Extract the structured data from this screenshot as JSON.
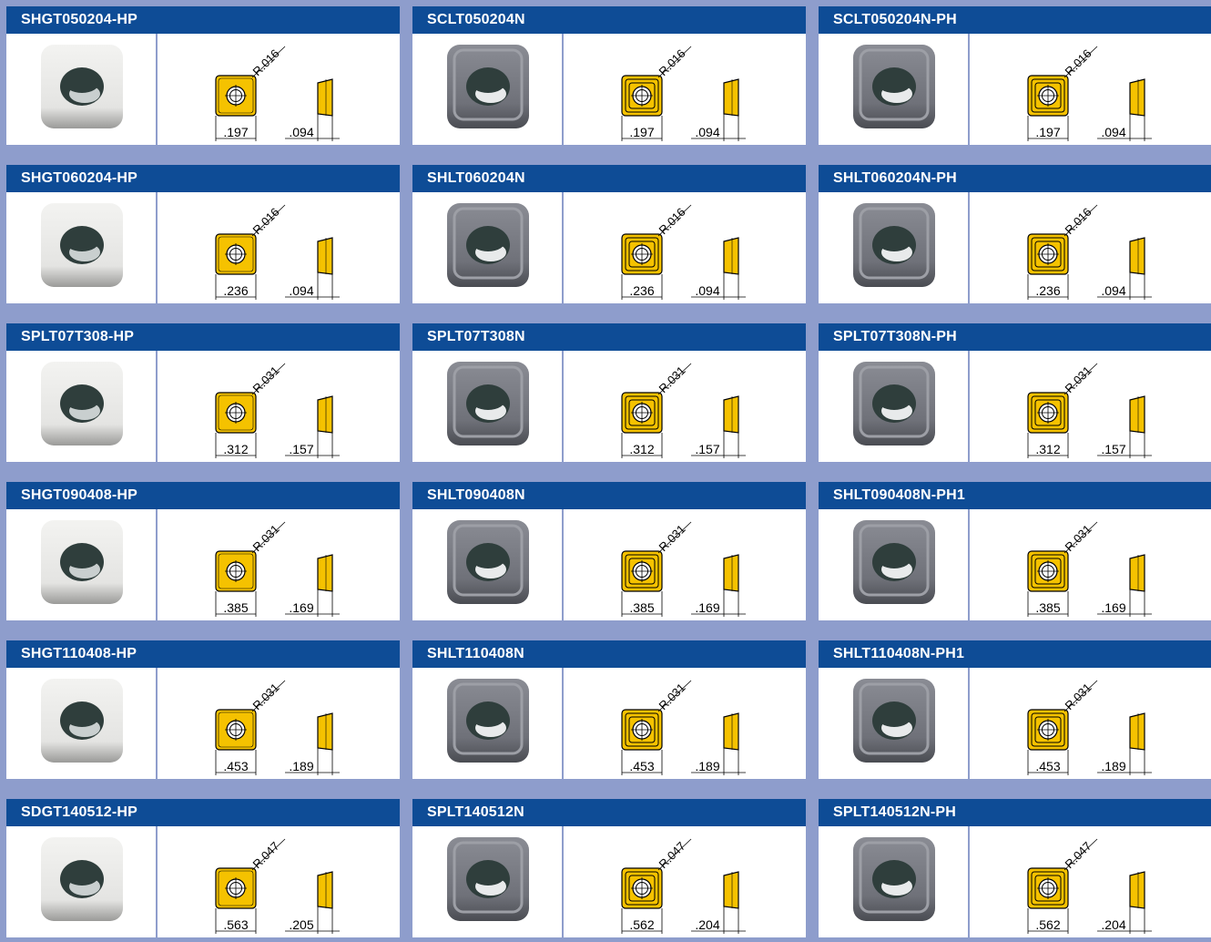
{
  "colors": {
    "background": "#8e9dcc",
    "header": "#0e4c96",
    "insert_yellow": "#f5c200",
    "carbide_grey": "#6f7179",
    "ceramic_white": "#e4e4e2",
    "hole": "#2f3e3c"
  },
  "rows": [
    {
      "cards": [
        {
          "name": "SHGT050204-HP",
          "radius": "R.016",
          "width": ".197",
          "thickness": ".094",
          "material": "ceramic-insert-photo",
          "style": "plain"
        },
        {
          "name": "SCLT050204N",
          "radius": "R.016",
          "width": ".197",
          "thickness": ".094",
          "material": "carbide-insert-photo",
          "style": "chip"
        },
        {
          "name": "SCLT050204N-PH",
          "radius": "R.016",
          "width": ".197",
          "thickness": ".094",
          "material": "carbide-insert-photo",
          "style": "chip"
        }
      ]
    },
    {
      "cards": [
        {
          "name": "SHGT060204-HP",
          "radius": "R.016",
          "width": ".236",
          "thickness": ".094",
          "material": "ceramic-insert-photo",
          "style": "plain"
        },
        {
          "name": "SHLT060204N",
          "radius": "R.016",
          "width": ".236",
          "thickness": ".094",
          "material": "carbide-insert-photo",
          "style": "chip"
        },
        {
          "name": "SHLT060204N-PH",
          "radius": "R.016",
          "width": ".236",
          "thickness": ".094",
          "material": "carbide-insert-photo",
          "style": "chip"
        }
      ]
    },
    {
      "cards": [
        {
          "name": "SPLT07T308-HP",
          "radius": "R.031",
          "width": ".312",
          "thickness": ".157",
          "material": "ceramic-insert-photo",
          "style": "plain"
        },
        {
          "name": "SPLT07T308N",
          "radius": "R.031",
          "width": ".312",
          "thickness": ".157",
          "material": "carbide-insert-photo",
          "style": "chip"
        },
        {
          "name": "SPLT07T308N-PH",
          "radius": "R.031",
          "width": ".312",
          "thickness": ".157",
          "material": "carbide-insert-photo",
          "style": "chip"
        }
      ]
    },
    {
      "cards": [
        {
          "name": "SHGT090408-HP",
          "radius": "R.031",
          "width": ".385",
          "thickness": ".169",
          "material": "ceramic-insert-photo",
          "style": "plain"
        },
        {
          "name": "SHLT090408N",
          "radius": "R.031",
          "width": ".385",
          "thickness": ".169",
          "material": "carbide-insert-photo",
          "style": "chip"
        },
        {
          "name": "SHLT090408N-PH1",
          "radius": "R.031",
          "width": ".385",
          "thickness": ".169",
          "material": "carbide-insert-photo",
          "style": "chip"
        }
      ]
    },
    {
      "cards": [
        {
          "name": "SHGT110408-HP",
          "radius": "R.031",
          "width": ".453",
          "thickness": ".189",
          "material": "ceramic-insert-photo",
          "style": "plain"
        },
        {
          "name": "SHLT110408N",
          "radius": "R.031",
          "width": ".453",
          "thickness": ".189",
          "material": "carbide-insert-photo",
          "style": "chip"
        },
        {
          "name": "SHLT110408N-PH1",
          "radius": "R.031",
          "width": ".453",
          "thickness": ".189",
          "material": "carbide-insert-photo",
          "style": "chip"
        }
      ]
    },
    {
      "cards": [
        {
          "name": "SDGT140512-HP",
          "radius": "R.047",
          "width": ".563",
          "thickness": ".205",
          "material": "ceramic-insert-photo",
          "style": "plain"
        },
        {
          "name": "SPLT140512N",
          "radius": "R.047",
          "width": ".562",
          "thickness": ".204",
          "material": "carbide-insert-photo",
          "style": "chip"
        },
        {
          "name": "SPLT140512N-PH",
          "radius": "R.047",
          "width": ".562",
          "thickness": ".204",
          "material": "carbide-insert-photo",
          "style": "chip"
        }
      ]
    }
  ]
}
